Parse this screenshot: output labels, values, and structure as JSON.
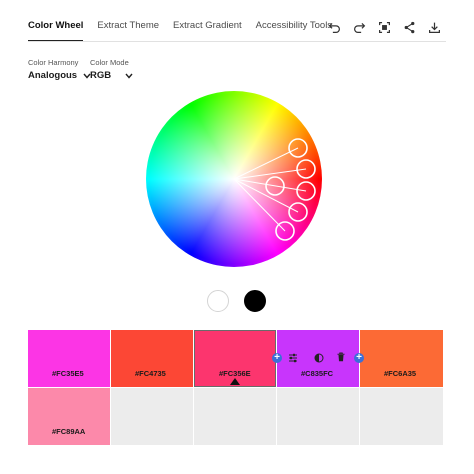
{
  "tabs": [
    "Color Wheel",
    "Extract Theme",
    "Extract Gradient",
    "Accessibility Tools"
  ],
  "toolbar": [
    "undo-icon",
    "redo-icon",
    "fit-screen-icon",
    "share-icon",
    "download-icon"
  ],
  "color_harmony": {
    "label": "Color Harmony",
    "value": "Analogous"
  },
  "color_mode": {
    "label": "Color Mode",
    "value": "RGB"
  },
  "brightness_options": [
    "white",
    "black"
  ],
  "swatches": [
    {
      "hex": "#FC35E5",
      "color": "#FC35E5"
    },
    {
      "hex": "#FC4735",
      "color": "#FC4735"
    },
    {
      "hex": "#FC356E",
      "color": "#FC356E",
      "selected": true
    },
    {
      "hex": "#C835FC",
      "color": "#C835FC"
    },
    {
      "hex": "#FC6A35",
      "color": "#FC6A35"
    },
    {
      "hex": "#FC89AA",
      "color": "#FC89AA"
    }
  ],
  "swatch_actions": [
    "adjust-sliders-icon",
    "contrast-icon",
    "delete-icon"
  ]
}
